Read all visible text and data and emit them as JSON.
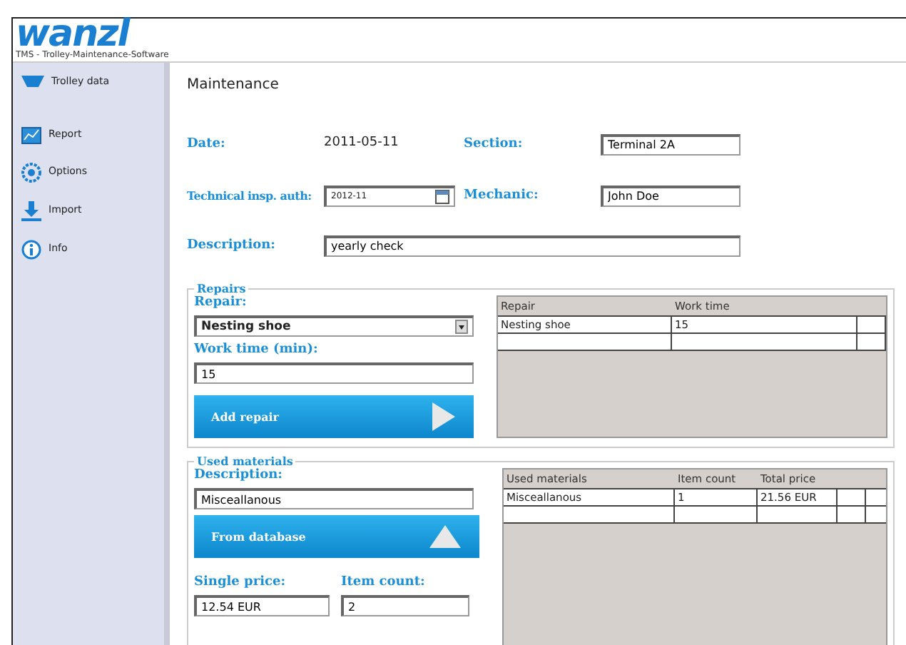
{
  "app": {
    "logo": "wanzl",
    "subtitle": "TMS - Trolley-Maintenance-Software"
  },
  "sidebar": {
    "items": [
      {
        "label": "Trolley data",
        "selected": false
      },
      {
        "label": "Report",
        "selected": false
      },
      {
        "label": "Options",
        "selected": false
      },
      {
        "label": "Import",
        "selected": false
      },
      {
        "label": "Info",
        "selected": false
      }
    ]
  },
  "page_title": "Maintenance",
  "form": {
    "date_label": "Date:",
    "date": "2011-05-11",
    "section_label": "Section:",
    "section": "Terminal 2A",
    "insp_label": "Technical insp. auth:",
    "insp": "2012-11",
    "mechanic_label": "Mechanic:",
    "mechanic": "John Doe",
    "description_label": "Description:",
    "description": "yearly check"
  },
  "repairs": {
    "legend": "Repairs",
    "repair_label": "Repair:",
    "repair": "Nesting shoe",
    "work_label": "Work time (min):",
    "work": "15",
    "button": "Add repair",
    "table": {
      "columns": [
        "Repair",
        "Work time"
      ],
      "rows": [
        [
          "Nesting shoe",
          "15"
        ],
        [
          "",
          ""
        ]
      ]
    }
  },
  "materials": {
    "legend": "Used materials",
    "description_label": "Description:",
    "description": "Misceallanous",
    "button": "From database",
    "price_label": "Single price:",
    "price": "12.54 EUR",
    "count_label": "Item count:",
    "count": "2",
    "table": {
      "columns": [
        "Used materials",
        "Item count",
        "Total price"
      ],
      "rows": [
        [
          "Misceallanous",
          "1",
          "21.56 EUR"
        ],
        [
          "",
          "",
          ""
        ]
      ]
    }
  }
}
